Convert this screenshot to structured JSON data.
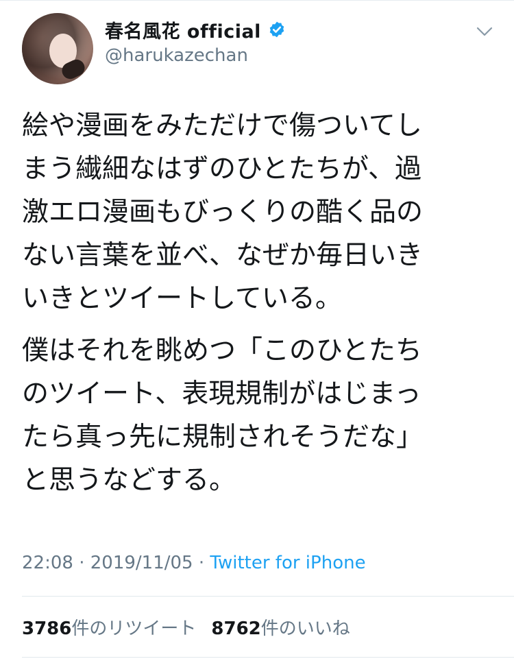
{
  "user": {
    "display_name": "春名風花 official",
    "handle": "@harukazechan",
    "verified": true,
    "avatar_icon": "profile-photo"
  },
  "menu": {
    "icon": "chevron-down-icon"
  },
  "tweet": {
    "paragraphs": [
      "絵や漫画をみただけで傷ついてし\nまう繊細なはずのひとたちが、過\n激エロ漫画もびっくりの酷く品の\nない言葉を並べ、なぜか毎日いき\nいきとツイートしている。",
      "僕はそれを眺めつ「このひとたち\nのツイート、表現規制がはじまっ\nたら真っ先に規制されそうだな」\nと思うなどする。"
    ],
    "time": "22:08",
    "separator": "·",
    "date": "2019/11/05",
    "source": "Twitter for iPhone"
  },
  "stats": {
    "retweets_count": "3786",
    "retweets_label": "件のリツイート",
    "likes_count": "8762",
    "likes_label": "件のいいね"
  },
  "colors": {
    "text": "#14171a",
    "secondary": "#657786",
    "link": "#1da1f2",
    "verified": "#1da1f2",
    "divider": "#e1e8ed"
  }
}
